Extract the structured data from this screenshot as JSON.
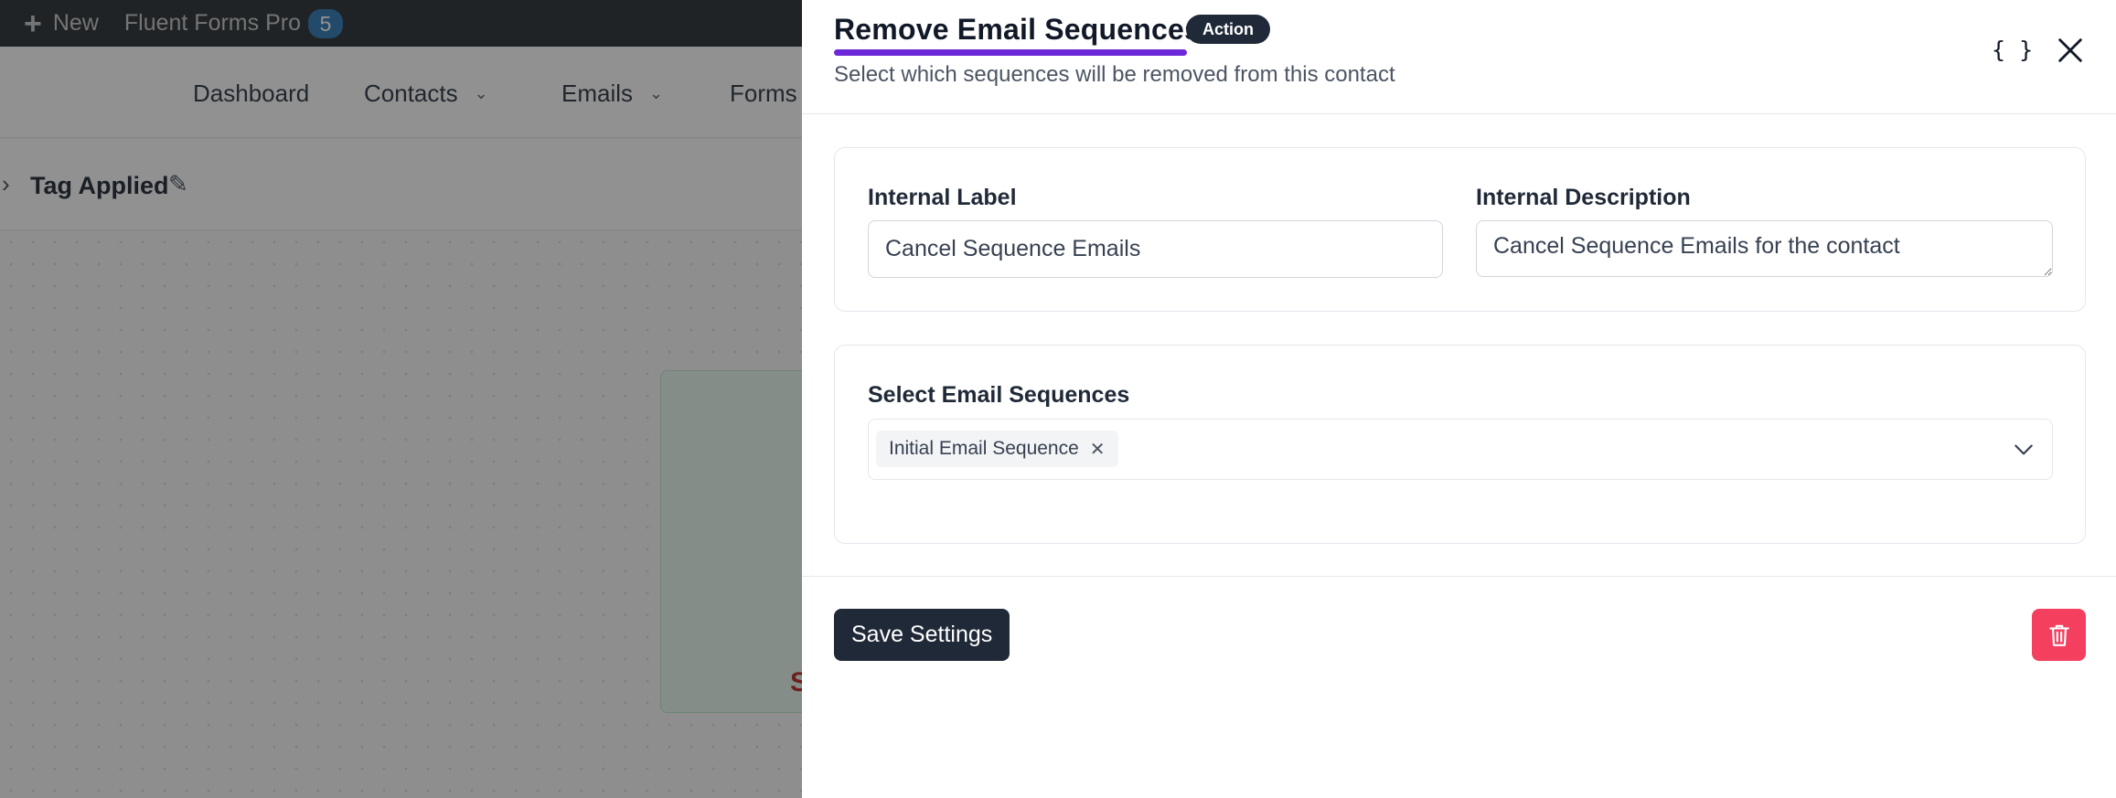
{
  "admin_bar": {
    "new_label": "New",
    "plugin_label": "Fluent Forms Pro",
    "plugin_count": "5"
  },
  "app_nav": {
    "items": [
      {
        "label": "Dashboard"
      },
      {
        "label": "Contacts"
      },
      {
        "label": "Emails"
      },
      {
        "label": "Forms"
      }
    ]
  },
  "funnel": {
    "step_title": "Tag Applied",
    "node_partial_text": "S"
  },
  "drawer": {
    "title": "Remove Email Sequences",
    "badge": "Action",
    "subtitle": "Select which sequences will be removed from this contact",
    "fields": {
      "internal_label": {
        "label": "Internal Label",
        "value": "Cancel Sequence Emails"
      },
      "internal_description": {
        "label": "Internal Description",
        "value": "Cancel Sequence Emails for the contact"
      }
    },
    "sequences": {
      "label": "Select Email Sequences",
      "selected": [
        "Initial Email Sequence"
      ]
    },
    "save_label": "Save Settings"
  },
  "colors": {
    "accent_underline": "#6d28d9",
    "primary_button": "#1f2937",
    "danger_button": "#f43f5e",
    "admin_bar": "#1d2327",
    "count_badge": "#2271b1"
  },
  "icons": {
    "code": "code-braces-icon",
    "close": "close-icon",
    "remove_tag": "close-icon",
    "dropdown": "chevron-down-icon",
    "delete": "trash-icon"
  }
}
